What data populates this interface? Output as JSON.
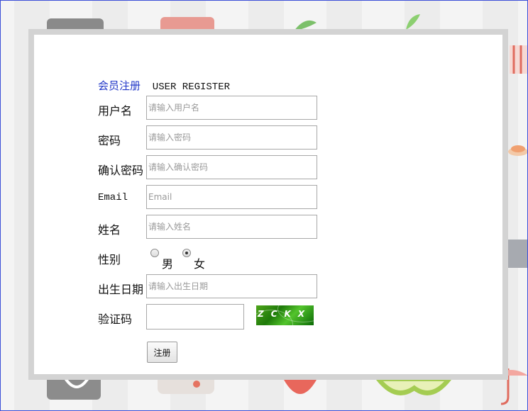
{
  "form": {
    "title_cn": "会员注册",
    "title_en": "USER REGISTER",
    "fields": {
      "username": {
        "label": "用户名",
        "placeholder": "请输入用户名",
        "value": ""
      },
      "password": {
        "label": "密码",
        "placeholder": "请输入密码",
        "value": ""
      },
      "confirm_password": {
        "label": "确认密码",
        "placeholder": "请输入确认密码",
        "value": ""
      },
      "email": {
        "label": "Email",
        "placeholder": "Email",
        "value": ""
      },
      "name": {
        "label": "姓名",
        "placeholder": "请输入姓名",
        "value": ""
      },
      "gender": {
        "label": "性别",
        "options": [
          "男",
          "女"
        ],
        "selected": "女"
      },
      "birthday": {
        "label": "出生日期",
        "placeholder": "请输入出生日期",
        "value": ""
      },
      "captcha": {
        "label": "验证码",
        "value": "",
        "image_text": "ZCKX"
      }
    },
    "submit_label": "注册"
  },
  "colors": {
    "title_accent": "#1f35c7",
    "captcha_bg": "#2f8f12",
    "modal_border": "#d3d3d3"
  }
}
